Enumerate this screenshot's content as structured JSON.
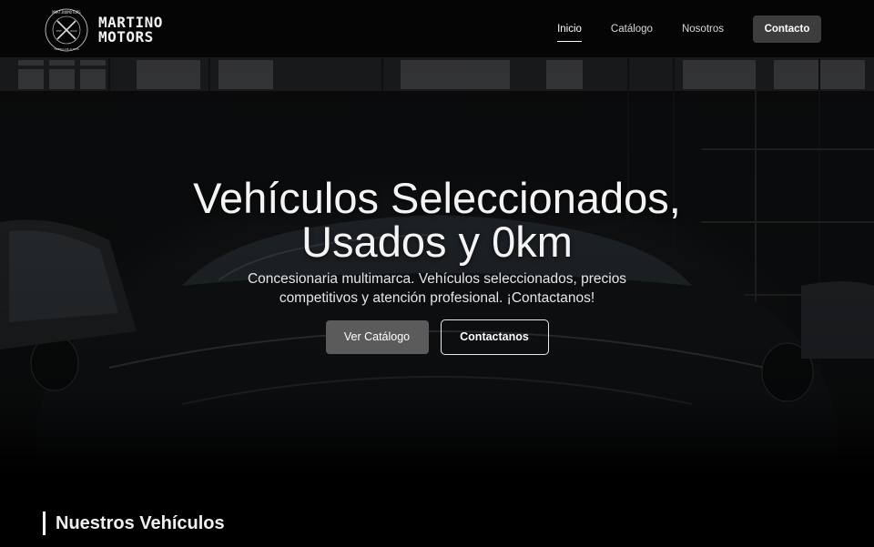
{
  "brand": {
    "name_line1": "MARTINO",
    "name_line2": "MOTORS",
    "emblem_text_top": "MARTINOMOTORS",
    "emblem_text_bottom": "TIENDA DE AUTOS",
    "emblem_est": "EST",
    "emblem_year": "2022"
  },
  "nav": {
    "items": [
      {
        "label": "Inicio",
        "active": true
      },
      {
        "label": "Catálogo",
        "active": false
      },
      {
        "label": "Nosotros",
        "active": false
      }
    ],
    "contact_label": "Contacto"
  },
  "hero": {
    "title_line1": "Vehículos Seleccionados,",
    "title_line2": "Usados y 0km",
    "subtitle": "Concesionaria multimarca. Vehículos seleccionados, precios competitivos y atención profesional. ¡Contactanos!",
    "primary_button": "Ver Catálogo",
    "secondary_button": "Contactanos"
  },
  "section": {
    "title": "Nuestros Vehículos"
  },
  "colors": {
    "background": "#000000",
    "navbar": "#050505",
    "contact_button": "#3d3d3d",
    "catalog_button": "#5b5b5b",
    "text": "#ffffff"
  }
}
